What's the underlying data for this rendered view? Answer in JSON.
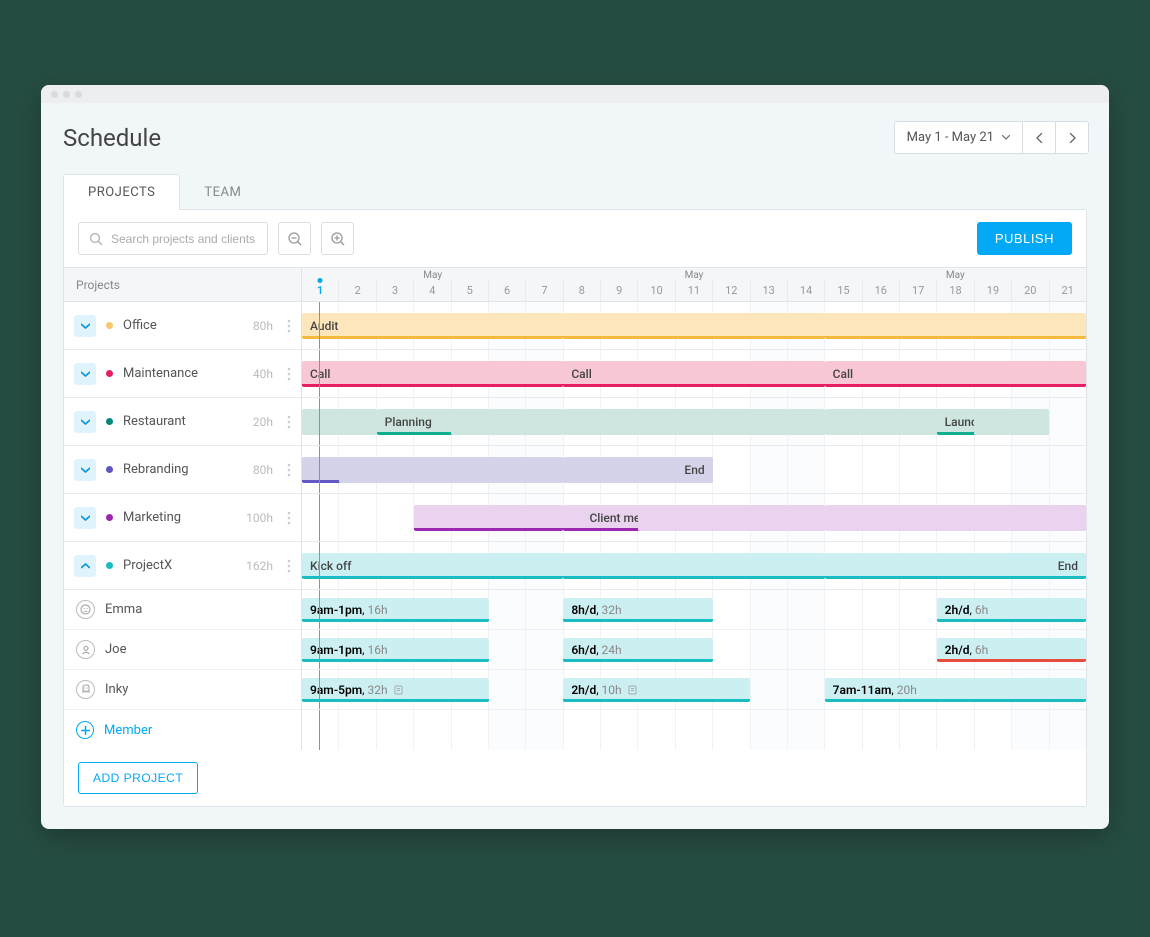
{
  "page_title": "Schedule",
  "date_range": "May 1 - May 21",
  "tabs": {
    "projects": "PROJECTS",
    "team": "TEAM"
  },
  "search_placeholder": "Search projects and clients",
  "publish_button": "PUBLISH",
  "projects_header": "Projects",
  "month_label": "May",
  "days": [
    "1",
    "2",
    "3",
    "4",
    "5",
    "6",
    "7",
    "8",
    "9",
    "10",
    "11",
    "12",
    "13",
    "14",
    "15",
    "16",
    "17",
    "18",
    "19",
    "20",
    "21"
  ],
  "weekends": [
    6,
    7,
    13,
    14,
    20,
    21
  ],
  "current_day": 1,
  "projects": [
    {
      "name": "Office",
      "hours": "80h",
      "color": "#f7c76a",
      "expanded": false,
      "bars": [
        {
          "start": 1,
          "end": 5,
          "label": "Audit",
          "bg": "#fde6bb",
          "line": "#f5b93c",
          "hatch": true
        },
        {
          "start": 5,
          "end": 7,
          "bg": "#fde6bb",
          "line": "#f5b93c"
        },
        {
          "start": 8,
          "end": 14,
          "bg": "#fde6bb",
          "line": "#f5b93c"
        },
        {
          "start": 15,
          "end": 21,
          "bg": "#fde6bb",
          "line": "#f5b93c"
        },
        {
          "start": 21,
          "end": 21.9,
          "bg": "#fde6bb",
          "line": "#f5b93c",
          "open": true
        }
      ]
    },
    {
      "name": "Maintenance",
      "hours": "40h",
      "color": "#e81e63",
      "expanded": false,
      "bars": [
        {
          "start": 1,
          "end": 3,
          "label": "Call",
          "bg": "#f7c8d4",
          "line": "#e81e63",
          "hatch": true
        },
        {
          "start": 3,
          "end": 7,
          "bg": "#f7c8d4",
          "line": "#e81e63"
        },
        {
          "start": 8,
          "end": 14,
          "label": "Call",
          "bg": "#f7c8d4",
          "line": "#e81e63"
        },
        {
          "start": 15,
          "end": 21,
          "label": "Call",
          "bg": "#f7c8d4",
          "line": "#e81e63"
        },
        {
          "start": 21,
          "end": 21.9,
          "bg": "#f7c8d4",
          "line": "#e81e63",
          "open": true
        }
      ]
    },
    {
      "name": "Restaurant",
      "hours": "20h",
      "color": "#00897b",
      "expanded": false,
      "bars": [
        {
          "start": 1,
          "end": 2,
          "bg": "#cee6df",
          "line": "#cee6df",
          "hatch": true
        },
        {
          "start": 3,
          "end": 5,
          "label": "Planning",
          "bg": "#cee6df",
          "line": "#0fae8f"
        },
        {
          "start": 5,
          "end": 7,
          "bg": "#cee6df",
          "line": "#cee6df"
        },
        {
          "start": 8,
          "end": 14,
          "bg": "#cee6df",
          "line": "#cee6df"
        },
        {
          "start": 15,
          "end": 18,
          "bg": "#cee6df",
          "line": "#cee6df"
        },
        {
          "start": 18,
          "end": 19,
          "label": "Launch",
          "bg": "#cee6df",
          "line": "#0fae8f"
        },
        {
          "start": 19,
          "end": 20,
          "bg": "#cee6df",
          "line": "#cee6df",
          "hatch": true
        }
      ]
    },
    {
      "name": "Rebranding",
      "hours": "80h",
      "color": "#5e55c5",
      "expanded": false,
      "bars": [
        {
          "start": 1,
          "end": 2,
          "bg": "#d5d3ea",
          "line": "#6159c6",
          "hatch": true
        },
        {
          "start": 2,
          "end": 7,
          "bg": "#d5d3ea",
          "line": "#d5d3ea"
        },
        {
          "start": 8,
          "end": 11,
          "label": "End",
          "align": "right",
          "bg": "#d5d3ea",
          "line": "#d5d3ea",
          "hatchend": true
        }
      ]
    },
    {
      "name": "Marketing",
      "hours": "100h",
      "color": "#9c27b0",
      "expanded": false,
      "bars": [
        {
          "start": 4,
          "end": 7,
          "bg": "#ead3ee",
          "line": "#9c27b0"
        },
        {
          "start": 8,
          "end": 10,
          "label": "Client meeting",
          "align": "right",
          "bg": "#ead3ee",
          "line": "#9c27b0"
        },
        {
          "start": 10,
          "end": 14,
          "bg": "#ead3ee",
          "line": "#ead3ee"
        },
        {
          "start": 15,
          "end": 21,
          "bg": "#ead3ee",
          "line": "#ead3ee"
        },
        {
          "start": 21,
          "end": 21.9,
          "bg": "#ead3ee",
          "line": "#ead3ee",
          "open": true
        }
      ]
    },
    {
      "name": "ProjectX",
      "hours": "162h",
      "color": "#19bcc2",
      "expanded": true,
      "bars": [
        {
          "start": 1,
          "end": 3,
          "label": "Kick off",
          "bg": "#ccf0f1",
          "line": "#19bcc2",
          "hatch": true
        },
        {
          "start": 3,
          "end": 7,
          "bg": "#ccf0f1",
          "line": "#19bcc2"
        },
        {
          "start": 8,
          "end": 14,
          "bg": "#ccf0f1",
          "line": "#19bcc2"
        },
        {
          "start": 15,
          "end": 19,
          "bg": "#ccf0f1",
          "line": "#19bcc2"
        },
        {
          "start": 19,
          "end": 21,
          "label": "End",
          "align": "right",
          "bg": "#ccf0f1",
          "line": "#19bcc2",
          "hatchend": true
        }
      ],
      "members": [
        {
          "name": "Emma",
          "icon": "face",
          "assignments": [
            {
              "start": 1,
              "end": 5,
              "time": "9am-1pm",
              "hours": "16h",
              "note": false
            },
            {
              "start": 8,
              "end": 11,
              "time": "8h/d",
              "hours": "32h",
              "note": false
            },
            {
              "start": 18,
              "end": 21,
              "time": "2h/d",
              "hours": "6h",
              "note": false
            }
          ]
        },
        {
          "name": "Joe",
          "icon": "person",
          "assignments": [
            {
              "start": 1,
              "end": 5,
              "time": "9am-1pm",
              "hours": "16h",
              "note": false
            },
            {
              "start": 8,
              "end": 11,
              "time": "6h/d",
              "hours": "24h",
              "note": false
            },
            {
              "start": 18,
              "end": 21,
              "time": "2h/d",
              "hours": "6h",
              "note": false,
              "warn": true
            }
          ]
        },
        {
          "name": "Inky",
          "icon": "ghost",
          "assignments": [
            {
              "start": 1,
              "end": 5,
              "time": "9am-5pm",
              "hours": "32h",
              "note": true
            },
            {
              "start": 8,
              "end": 12,
              "time": "2h/d",
              "hours": "10h",
              "note": true
            },
            {
              "start": 15,
              "end": 21,
              "time": "7am-11am",
              "hours": "20h",
              "note": false
            }
          ]
        }
      ]
    }
  ],
  "add_member": "Member",
  "add_project": "ADD PROJECT"
}
